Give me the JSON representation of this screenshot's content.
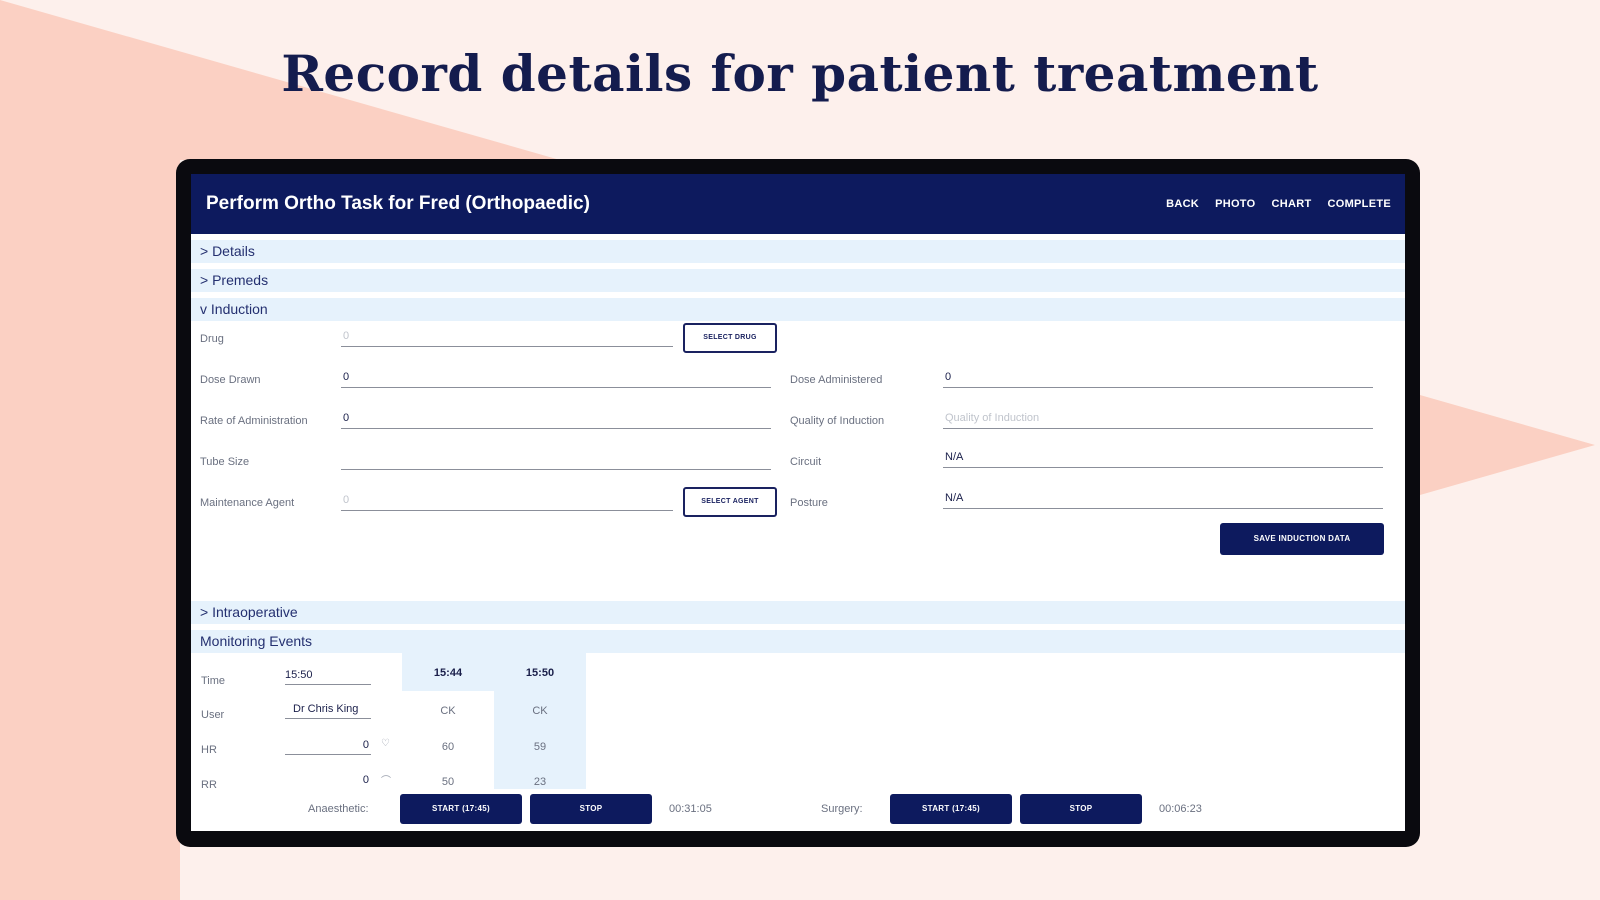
{
  "headline": "Record details for patient treatment",
  "colors": {
    "navy": "#0d1a5e",
    "section_bg": "#e6f2fc",
    "peach_bg": "#fdf0ec",
    "shape": "#fbd0c3"
  },
  "appbar": {
    "title": "Perform Ortho Task for Fred (Orthopaedic)",
    "actions": [
      "BACK",
      "PHOTO",
      "CHART",
      "COMPLETE"
    ]
  },
  "sections": {
    "details": "> Details",
    "premeds": "> Premeds",
    "induction": "v Induction",
    "intraoperative": "> Intraoperative",
    "monitoring": "Monitoring Events"
  },
  "induction": {
    "drug": {
      "label": "Drug",
      "value": "0",
      "button": "SELECT DRUG"
    },
    "dose_drawn": {
      "label": "Dose Drawn",
      "value": "0"
    },
    "dose_administered": {
      "label": "Dose Administered",
      "value": "0"
    },
    "rate": {
      "label": "Rate of Administration",
      "value": "0"
    },
    "quality": {
      "label": "Quality of Induction",
      "placeholder": "Quality of Induction"
    },
    "tube_size": {
      "label": "Tube Size",
      "value": ""
    },
    "circuit": {
      "label": "Circuit",
      "value": "N/A"
    },
    "maintenance": {
      "label": "Maintenance Agent",
      "value": "0",
      "button": "SELECT AGENT"
    },
    "posture": {
      "label": "Posture",
      "value": "N/A"
    },
    "save_button": "SAVE INDUCTION DATA"
  },
  "monitoring": {
    "time": {
      "label": "Time",
      "value": "15:50"
    },
    "user": {
      "label": "User",
      "value": "Dr Chris King"
    },
    "hr": {
      "label": "HR",
      "value": "0"
    },
    "rr": {
      "label": "RR",
      "value": "0"
    },
    "col1": {
      "time": "15:44",
      "user": "CK",
      "hr": "60",
      "rr": "50"
    },
    "col2": {
      "time": "15:50",
      "user": "CK",
      "hr": "59",
      "rr": "23"
    }
  },
  "timers": {
    "anaesthetic_label": "Anaesthetic:",
    "anaesthetic_start": "START (17:45)",
    "anaesthetic_stop": "STOP",
    "anaesthetic_elapsed": "00:31:05",
    "surgery_label": "Surgery:",
    "surgery_start": "START (17:45)",
    "surgery_stop": "STOP",
    "surgery_elapsed": "00:06:23"
  }
}
